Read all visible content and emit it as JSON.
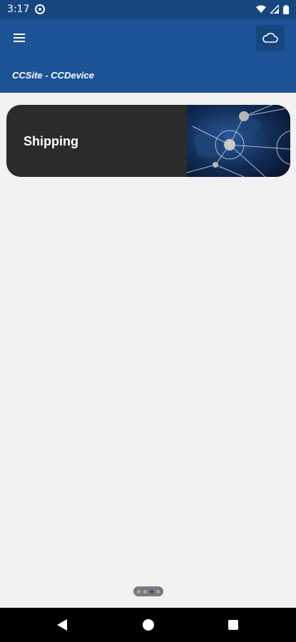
{
  "status_bar": {
    "time": "3:17"
  },
  "header": {
    "title": "CCSite - CCDevice"
  },
  "cards": [
    {
      "label": "Shipping"
    }
  ],
  "pager": {
    "total": 3,
    "active_index": 2
  },
  "colors": {
    "app_bar": "#1b5396",
    "status_bar": "#17467f",
    "card_bg": "#2b2b2b",
    "page_bg": "#f2f2f2"
  },
  "icons": [
    "menu-icon",
    "cloud-icon",
    "wifi-icon",
    "signal-icon",
    "battery-icon",
    "gear-icon"
  ]
}
